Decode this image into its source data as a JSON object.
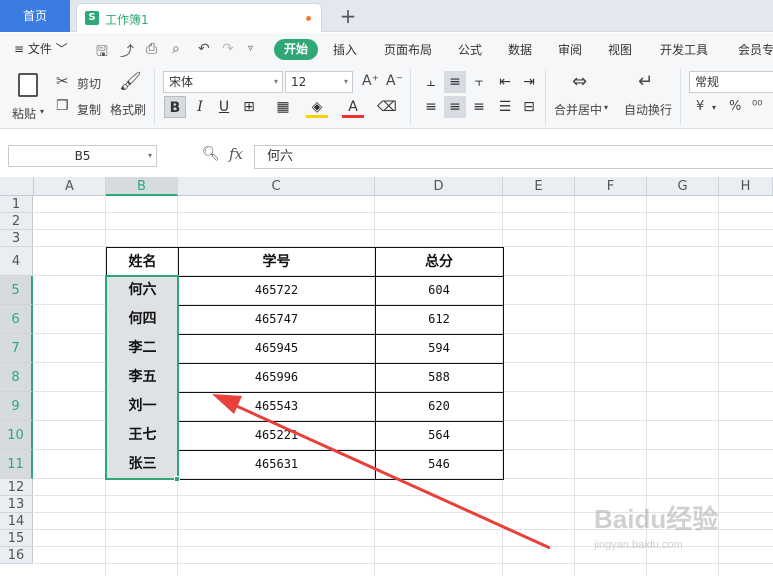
{
  "tabs": {
    "home": "首页",
    "workbook": "工作簿1",
    "workbook_icon": "S",
    "add": "+"
  },
  "menu": {
    "file": "≡ 文件 ﹀",
    "items": [
      "开始",
      "插入",
      "页面布局",
      "公式",
      "数据",
      "审阅",
      "视图",
      "开发工具",
      "会员专"
    ],
    "active": "开始"
  },
  "ribbon": {
    "paste": "粘贴",
    "cut": "剪切",
    "copy": "复制",
    "format_painter": "格式刷",
    "font_name": "宋体",
    "font_size": "12",
    "font_grow": "A⁺",
    "font_shrink": "A⁻",
    "merge_center": "合并居中",
    "wrap_text": "自动换行",
    "number_format": "常规",
    "currency": "¥",
    "percent": "%"
  },
  "formula": {
    "name_box": "B5",
    "fx": "fx",
    "value": "何六"
  },
  "columns": [
    "A",
    "B",
    "C",
    "D",
    "E",
    "F",
    "G",
    "H"
  ],
  "active_column": "B",
  "rows": [
    "1",
    "2",
    "3",
    "4",
    "5",
    "6",
    "7",
    "8",
    "9",
    "10",
    "11",
    "12",
    "13",
    "14",
    "15",
    "16"
  ],
  "active_rows": [
    "5",
    "6",
    "7",
    "8",
    "9",
    "10",
    "11"
  ],
  "table": {
    "headers": [
      "姓名",
      "学号",
      "总分"
    ],
    "rows": [
      {
        "name": "何六",
        "id": "465722",
        "score": "604"
      },
      {
        "name": "何四",
        "id": "465747",
        "score": "612"
      },
      {
        "name": "李二",
        "id": "465945",
        "score": "594"
      },
      {
        "name": "李五",
        "id": "465996",
        "score": "588"
      },
      {
        "name": "刘一",
        "id": "465543",
        "score": "620"
      },
      {
        "name": "王七",
        "id": "465221",
        "score": "564"
      },
      {
        "name": "张三",
        "id": "465631",
        "score": "546"
      }
    ]
  },
  "watermark": {
    "text": "Baidu经验",
    "sub": "jingyan.baidu.com"
  },
  "colors": {
    "accent": "#2fa876",
    "home_tab": "#3a7ce0",
    "arrow": "#e8403a"
  }
}
